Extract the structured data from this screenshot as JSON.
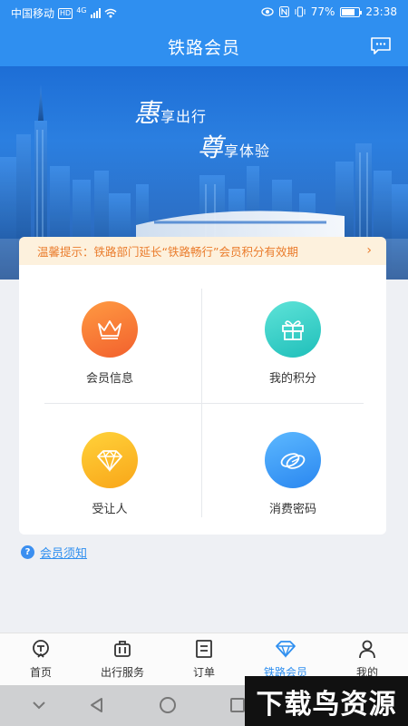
{
  "status_bar": {
    "carrier": "中国移动",
    "network_badge": "HD",
    "network_type": "4G",
    "battery": "77%",
    "time": "23:38",
    "icons": [
      "eye-icon",
      "nfc-icon",
      "vibrate-icon",
      "battery-icon",
      "wifi-icon",
      "signal-icon"
    ]
  },
  "header": {
    "title": "铁路会员",
    "message_icon": "message-icon"
  },
  "banner": {
    "line1_big": "惠",
    "line1_rest": "享出行",
    "line2_big": "尊",
    "line2_rest": "享体验"
  },
  "notice": {
    "text": "温馨提示：铁路部门延长“铁路畅行”会员积分有效期",
    "arrow": "›"
  },
  "grid": [
    {
      "label": "会员信息",
      "icon": "crown-icon"
    },
    {
      "label": "我的积分",
      "icon": "gift-icon"
    },
    {
      "label": "受让人",
      "icon": "diamond-icon"
    },
    {
      "label": "消费密码",
      "icon": "coins-icon"
    }
  ],
  "member_notice": {
    "label": "会员须知",
    "icon": "question-icon"
  },
  "tabs": [
    {
      "label": "首页",
      "icon": "home-train-icon",
      "active": false
    },
    {
      "label": "出行服务",
      "icon": "luggage-icon",
      "active": false
    },
    {
      "label": "订单",
      "icon": "order-icon",
      "active": false
    },
    {
      "label": "铁路会员",
      "icon": "diamond-icon",
      "active": true
    },
    {
      "label": "我的",
      "icon": "person-icon",
      "active": false
    }
  ],
  "colors": {
    "primary": "#2f8ff0",
    "notice_bg": "#fdf1dd",
    "notice_text": "#ea7c2c"
  },
  "watermark": "下载鸟资源"
}
